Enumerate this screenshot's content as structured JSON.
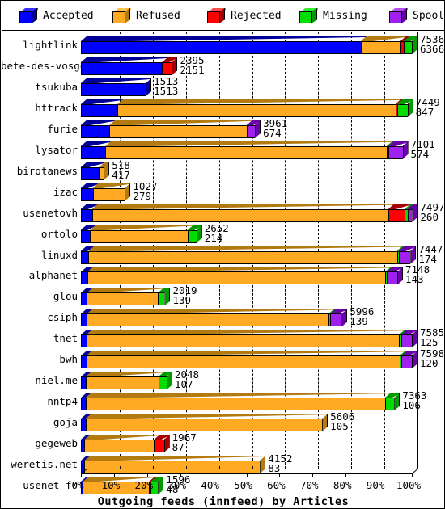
{
  "legend": {
    "items": [
      {
        "label": "Accepted",
        "color": "#0000ff",
        "dark": "#000099",
        "top": "#3333ff",
        "icon": "cube-icon"
      },
      {
        "label": "Refused",
        "color": "#ffaa22",
        "dark": "#b37a10",
        "top": "#ffc04d",
        "icon": "cube-icon"
      },
      {
        "label": "Rejected",
        "color": "#ff0000",
        "dark": "#a80000",
        "top": "#ff4d4d",
        "icon": "cube-icon"
      },
      {
        "label": "Missing",
        "color": "#00dd00",
        "dark": "#009900",
        "top": "#33ee33",
        "icon": "cube-icon"
      },
      {
        "label": "Spooled",
        "color": "#a020f0",
        "dark": "#6a00a8",
        "top": "#b84df5",
        "icon": "cube-icon"
      }
    ]
  },
  "chart_data": {
    "type": "bar",
    "orientation": "horizontal",
    "stacked": true,
    "title": "Outgoing feeds (innfeed) by Articles",
    "xlabel": "Outgoing feeds (innfeed) by Articles",
    "ylabel": "",
    "xlim": [
      0,
      100
    ],
    "xticks": [
      "0%",
      "10%",
      "20%",
      "30%",
      "40%",
      "50%",
      "60%",
      "70%",
      "80%",
      "90%",
      "100%"
    ],
    "grid": true,
    "legend_position": "top",
    "series": [
      {
        "name": "Accepted",
        "color": "#0000ff"
      },
      {
        "name": "Refused",
        "color": "#ffaa22"
      },
      {
        "name": "Rejected",
        "color": "#ff0000"
      },
      {
        "name": "Missing",
        "color": "#00dd00"
      },
      {
        "name": "Spooled",
        "color": "#a020f0"
      }
    ],
    "categories": [
      "lightlink",
      "bete-des-vosges",
      "tsukuba",
      "httrack",
      "furie",
      "lysator",
      "birotanews",
      "izac",
      "usenetovh",
      "ortolo",
      "linuxd",
      "alphanet",
      "glou",
      "csiph",
      "tnet",
      "bwh",
      "niel.me",
      "nntp4",
      "goja",
      "gegeweb",
      "weretis.net",
      "usenet-fr"
    ],
    "rows": [
      {
        "category": "lightlink",
        "total": 7536,
        "accepted": 6366,
        "label_top": "7536",
        "label_bottom": "6366",
        "pct": [
          84.5,
          12.0,
          1.0,
          2.5,
          0.0
        ]
      },
      {
        "category": "bete-des-vosges",
        "total": 2395,
        "accepted": 2151,
        "label_top": "2395",
        "label_bottom": "2151",
        "pct": [
          24.5,
          0.0,
          3.0,
          0.0,
          0.0
        ]
      },
      {
        "category": "tsukuba",
        "total": 1513,
        "accepted": 1513,
        "label_top": "1513",
        "label_bottom": "1513",
        "pct": [
          19.6,
          0.0,
          0.0,
          0.0,
          0.0
        ]
      },
      {
        "category": "httrack",
        "total": 7449,
        "accepted": 847,
        "label_top": "7449",
        "label_bottom": "847",
        "pct": [
          11.0,
          84.0,
          0.5,
          3.2,
          0.0
        ]
      },
      {
        "category": "furie",
        "total": 3961,
        "accepted": 674,
        "label_top": "3961",
        "label_bottom": "674",
        "pct": [
          8.6,
          41.5,
          0.0,
          0.0,
          2.5
        ]
      },
      {
        "category": "lysator",
        "total": 7101,
        "accepted": 574,
        "label_top": "7101",
        "label_bottom": "574",
        "pct": [
          7.4,
          85.0,
          0.0,
          0.5,
          4.3
        ]
      },
      {
        "category": "birotanews",
        "total": 518,
        "accepted": 417,
        "label_top": "518",
        "label_bottom": "417",
        "pct": [
          5.5,
          1.4,
          0.0,
          0.0,
          0.0
        ]
      },
      {
        "category": "izac",
        "total": 1027,
        "accepted": 279,
        "label_top": "1027",
        "label_bottom": "279",
        "pct": [
          3.6,
          9.7,
          0.0,
          0.0,
          0.0
        ]
      },
      {
        "category": "usenetovh",
        "total": 7497,
        "accepted": 260,
        "label_top": "7497",
        "label_bottom": "260",
        "pct": [
          3.4,
          89.5,
          5.0,
          0.8,
          1.4
        ]
      },
      {
        "category": "ortolo",
        "total": 2652,
        "accepted": 214,
        "label_top": "2652",
        "label_bottom": "214",
        "pct": [
          2.8,
          29.5,
          0.0,
          2.6,
          0.0
        ]
      },
      {
        "category": "linuxd",
        "total": 7447,
        "accepted": 174,
        "label_top": "7447",
        "label_bottom": "174",
        "pct": [
          2.3,
          93.2,
          0.0,
          0.6,
          3.5
        ]
      },
      {
        "category": "alphanet",
        "total": 7148,
        "accepted": 143,
        "label_top": "7148",
        "label_bottom": "143",
        "pct": [
          1.9,
          90.0,
          0.0,
          0.5,
          3.2
        ]
      },
      {
        "category": "glou",
        "total": 2019,
        "accepted": 139,
        "label_top": "2019",
        "label_bottom": "139",
        "pct": [
          1.8,
          21.5,
          0.0,
          2.0,
          0.0
        ]
      },
      {
        "category": "csiph",
        "total": 5996,
        "accepted": 139,
        "label_top": "5996",
        "label_bottom": "139",
        "pct": [
          1.8,
          73.0,
          0.0,
          0.5,
          3.5
        ]
      },
      {
        "category": "tnet",
        "total": 7585,
        "accepted": 125,
        "label_top": "7585",
        "label_bottom": "125",
        "pct": [
          1.6,
          94.5,
          0.0,
          0.6,
          3.3
        ]
      },
      {
        "category": "bwh",
        "total": 7598,
        "accepted": 120,
        "label_top": "7598",
        "label_bottom": "120",
        "pct": [
          1.6,
          94.7,
          0.0,
          0.6,
          3.1
        ]
      },
      {
        "category": "niel.me",
        "total": 2048,
        "accepted": 107,
        "label_top": "2048",
        "label_bottom": "107",
        "pct": [
          1.4,
          22.0,
          0.0,
          2.5,
          0.0
        ]
      },
      {
        "category": "nntp4",
        "total": 7363,
        "accepted": 106,
        "label_top": "7363",
        "label_bottom": "106",
        "pct": [
          1.4,
          90.5,
          0.0,
          2.8,
          0.0
        ]
      },
      {
        "category": "goja",
        "total": 5606,
        "accepted": 105,
        "label_top": "5606",
        "label_bottom": "105",
        "pct": [
          1.4,
          71.5,
          0.0,
          0.0,
          0.0
        ]
      },
      {
        "category": "gegeweb",
        "total": 1967,
        "accepted": 87,
        "label_top": "1967",
        "label_bottom": "87",
        "pct": [
          1.1,
          21.0,
          3.0,
          0.0,
          0.0
        ]
      },
      {
        "category": "weretis.net",
        "total": 4152,
        "accepted": 83,
        "label_top": "4152",
        "label_bottom": "83",
        "pct": [
          1.1,
          53.0,
          0.0,
          0.0,
          0.0
        ]
      },
      {
        "category": "usenet-fr",
        "total": 1596,
        "accepted": 48,
        "label_top": "1596",
        "label_bottom": "48",
        "pct": [
          0.6,
          20.0,
          0.5,
          2.2,
          0.0
        ]
      }
    ]
  }
}
